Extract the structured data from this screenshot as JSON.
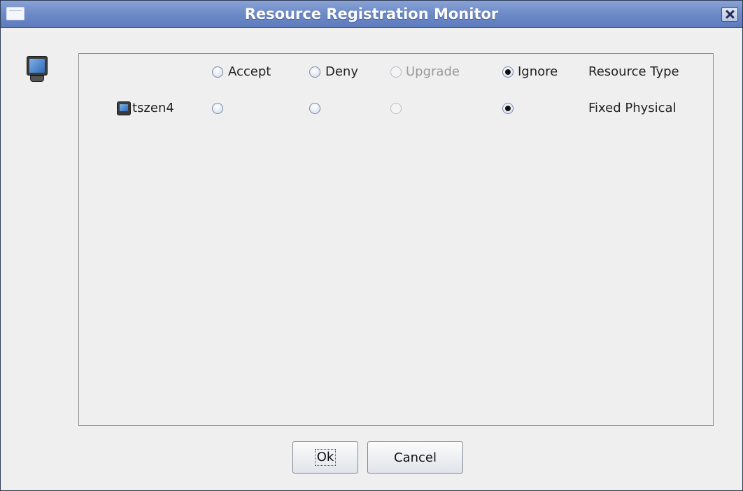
{
  "window": {
    "title": "Resource Registration Monitor",
    "icons": {
      "window_icon": "window-icon",
      "close": "close-icon",
      "dialog": "monitor-icon"
    }
  },
  "columns": {
    "accept": "Accept",
    "deny": "Deny",
    "upgrade": "Upgrade",
    "ignore": "Ignore",
    "resource_type": "Resource Type"
  },
  "header_selection": "Ignore",
  "rows": [
    {
      "name": "tszen4",
      "selection": "Ignore",
      "resource_type": "Fixed Physical"
    }
  ],
  "buttons": {
    "ok": "Ok",
    "cancel": "Cancel"
  },
  "colors": {
    "titlebar": "#6f8cc8",
    "background": "#efefef",
    "disabled_text": "#9a9a9a"
  }
}
